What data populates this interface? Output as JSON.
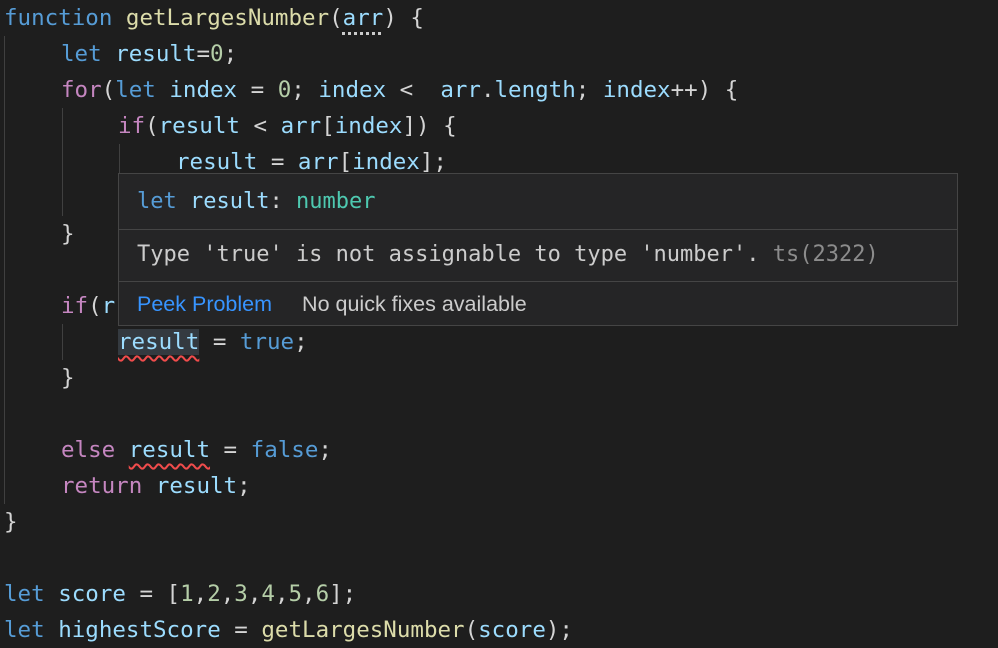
{
  "editor": {
    "lines": {
      "l1": {
        "kw": "function",
        "fn": "getLargesNumber",
        "paren_open": "(",
        "param": "arr",
        "paren_close": ") {"
      },
      "l2": {
        "kw": "let",
        "var": "result",
        "eq": "=",
        "num": "0",
        "semi": ";"
      },
      "l3": {
        "kw": "for",
        "p1": "(",
        "kw2": "let",
        "var": "index",
        "op1": " = ",
        "num": "0",
        "s1": "; ",
        "var2": "index",
        "op2": " <  ",
        "var3": "arr",
        "dot": ".",
        "prop": "length",
        "s2": "; ",
        "var4": "index",
        "rest": "++) {"
      },
      "l4": {
        "kw": "if",
        "p1": "(",
        "var": "result",
        "op": " < ",
        "var2": "arr",
        "b1": "[",
        "var3": "index",
        "rest": "]) {"
      },
      "l5": {
        "var": "result",
        "op": " = ",
        "var2": "arr",
        "b1": "[",
        "var3": "index",
        "rest": "];"
      },
      "l7": {
        "brace": "}"
      },
      "l9": {
        "kw": "if",
        "p1": "(",
        "var": "r"
      },
      "l10": {
        "var": "result",
        "op": " = ",
        "val": "true",
        "semi": ";"
      },
      "l11": {
        "brace": "}"
      },
      "l13": {
        "kw": "else",
        "sp": " ",
        "var": "result",
        "op": " = ",
        "val": "false",
        "semi": ";"
      },
      "l14": {
        "kw": "return",
        "sp": " ",
        "var": "result",
        "semi": ";"
      },
      "l15": {
        "brace": "}"
      },
      "l17": {
        "kw": "let",
        "sp": " ",
        "var": "score",
        "op": " = [",
        "n1": "1",
        "c1": ",",
        "n2": "2",
        "c2": ",",
        "n3": "3",
        "c3": ",",
        "n4": "4",
        "c4": ",",
        "n5": "5",
        "c5": ",",
        "n6": "6",
        "rest": "];"
      },
      "l18": {
        "kw": "let",
        "sp": " ",
        "var": "highestScore",
        "op": " = ",
        "fn": "getLargesNumber",
        "p1": "(",
        "var2": "score",
        "rest": ");"
      }
    }
  },
  "hover": {
    "signature": {
      "kw": "let",
      "name": "result",
      "colon": ": ",
      "type": "number"
    },
    "message": "Type 'true' is not assignable to type 'number'.",
    "code": "ts(2322)",
    "peek_problem": "Peek Problem",
    "no_quick_fixes": "No quick fixes available"
  },
  "colors": {
    "background": "#1e1e1e",
    "keyword": "#569cd6",
    "control": "#c586c0",
    "function": "#dcdcaa",
    "variable": "#9cdcfe",
    "number": "#b5cea8",
    "type": "#4ec9b0",
    "error_squiggle": "#f14c4c",
    "link": "#3794ff"
  }
}
